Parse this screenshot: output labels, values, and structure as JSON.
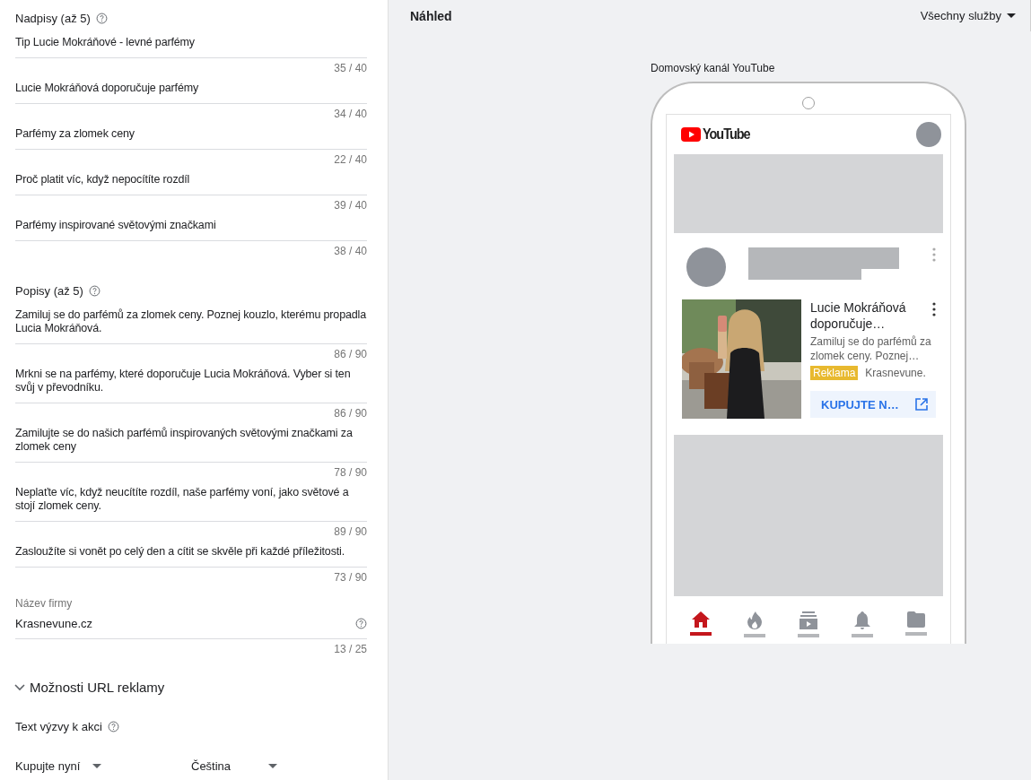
{
  "headlines": {
    "label": "Nadpisy (až 5)",
    "items": [
      {
        "value": "Tip Lucie Mokráňové - levné parfémy",
        "counter": "35 / 40"
      },
      {
        "value": "Lucie Mokráňová doporučuje parfémy",
        "counter": "34 / 40"
      },
      {
        "value": "Parfémy za zlomek ceny",
        "counter": "22 / 40"
      },
      {
        "value": "Proč platit víc, když nepocítíte rozdíl",
        "counter": "39 / 40"
      },
      {
        "value": "Parfémy inspirované světovými značkami",
        "counter": "38 / 40"
      }
    ]
  },
  "descriptions": {
    "label": "Popisy (až 5)",
    "items": [
      {
        "value": "Zamiluj se do parfémů za zlomek ceny. Poznej kouzlo, kterému propadla Lucia Mokráňová.",
        "counter": "86 / 90"
      },
      {
        "value": "Mrkni se na parfémy, které doporučuje Lucia Mokráňová. Vyber si ten svůj v převodníku.",
        "counter": "86 / 90"
      },
      {
        "value": "Zamilujte se do našich parfémů inspirovaných světovými značkami za zlomek ceny",
        "counter": "78 / 90"
      },
      {
        "value": "Neplaťte víc, když neucítíte rozdíl, naše parfémy voní, jako světové a stojí zlomek ceny.",
        "counter": "89 / 90"
      },
      {
        "value": "Zasloužíte si vonět po celý den a cítit se skvěle při každé příležitosti.",
        "counter": "73 / 90"
      }
    ]
  },
  "business_name": {
    "label": "Název firmy",
    "value": "Krasnevune.cz",
    "counter": "13 / 25"
  },
  "url_options": {
    "label": "Možnosti URL reklamy",
    "expanded": true
  },
  "call_to_action": {
    "label": "Text výzvy k akci",
    "selects": [
      {
        "value": "Kupujte nyní"
      },
      {
        "value": "Čeština"
      }
    ]
  },
  "preview": {
    "title": "Náhled",
    "filter": "Všechny služby",
    "placement": "Domovský kanál YouTube",
    "logo": "YouTube",
    "ad": {
      "title": "Lucie Mokráňová doporučuje…",
      "description": "Zamiluj se do parfémů za zlomek ceny. Poznej…",
      "badge": "Reklama",
      "advertiser": "Krasnevune.",
      "cta": "KUPUJTE N…"
    },
    "nav": [
      {
        "kind": "home",
        "selected": true
      },
      {
        "kind": "trending",
        "selected": false
      },
      {
        "kind": "subscriptions",
        "selected": false
      },
      {
        "kind": "notifications",
        "selected": false
      },
      {
        "kind": "library",
        "selected": false
      }
    ]
  }
}
